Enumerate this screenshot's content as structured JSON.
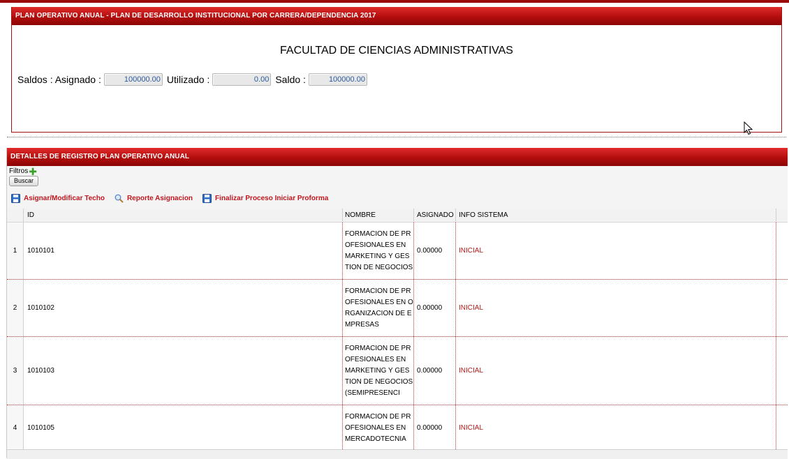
{
  "panel1": {
    "title": "PLAN OPERATIVO ANUAL - PLAN DE DESARROLLO INSTITUCIONAL POR CARRERA/DEPENDENCIA 2017",
    "faculty": "FACULTAD DE CIENCIAS ADMINISTRATIVAS",
    "saldos_label": "Saldos : Asignado :",
    "asignado_value": "100000.00",
    "utilizado_label": "Utilizado :",
    "utilizado_value": "0.00",
    "saldo_label": "Saldo :",
    "saldo_value": "100000.00"
  },
  "panel2": {
    "title": "DETALLES DE REGISTRO PLAN OPERATIVO ANUAL",
    "filters_label": "Filtros",
    "buscar_label": "Buscar",
    "toolbar": {
      "asignar": "Asignar/Modificar Techo",
      "reporte": "Reporte Asignacion",
      "finalizar": "Finalizar Proceso Iniciar Proforma"
    }
  },
  "grid": {
    "headers": {
      "id": "ID",
      "nombre": "NOMBRE",
      "asignado": "ASIGNADO",
      "info": "INFO SISTEMA"
    },
    "rows": [
      {
        "n": "1",
        "id": "1010101",
        "nombre": "FORMACION DE PROFESIONALES EN MARKETING Y GESTION DE NEGOCIOS",
        "asignado": "0.00000",
        "info": "INICIAL"
      },
      {
        "n": "2",
        "id": "1010102",
        "nombre": "FORMACION DE PROFESIONALES EN ORGANIZACION DE EMPRESAS",
        "asignado": "0.00000",
        "info": "INICIAL"
      },
      {
        "n": "3",
        "id": "1010103",
        "nombre": "FORMACION DE PROFESIONALES EN MARKETING Y GESTION DE NEGOCIOS (SEMIPRESENCI",
        "asignado": "0.00000",
        "info": "INICIAL"
      },
      {
        "n": "4",
        "id": "1010105",
        "nombre": "FORMACION DE PROFESIONALES EN MERCADOTECNIA",
        "asignado": "0.00000",
        "info": "INICIAL"
      }
    ]
  },
  "colors": {
    "header_red": "#b30d0d",
    "link_red": "#c0161d",
    "value_blue": "#2b5a9a",
    "add_green": "#3aa02a"
  }
}
